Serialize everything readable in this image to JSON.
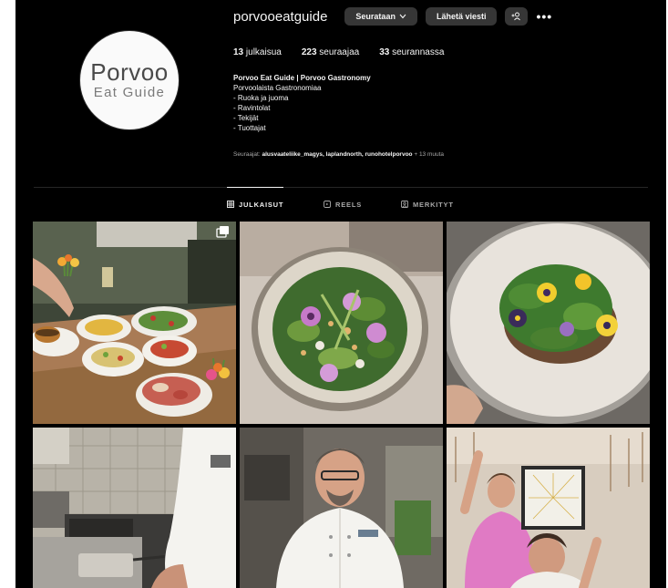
{
  "profile": {
    "username": "porvooeatguide",
    "following_btn": "Seurataan",
    "message_btn": "Lähetä viesti",
    "add_user_icon": "add-user-icon",
    "more_label": "•••"
  },
  "avatar": {
    "line1": "Porvoo",
    "line2": "Eat Guide"
  },
  "stats": {
    "posts": {
      "count": "13",
      "label": "julkaisua"
    },
    "followers": {
      "count": "223",
      "label": "seuraajaa"
    },
    "following": {
      "count": "33",
      "label": "seurannassa"
    }
  },
  "bio": {
    "name": "Porvoo Eat Guide | Porvoo Gastronomy",
    "lines": [
      "Porvoolaista Gastronomiaa",
      "- Ruoka ja juoma",
      "- Ravintolat",
      "- Tekijät",
      "- Tuottajat"
    ]
  },
  "followed_by": {
    "prefix": "Seuraajat:",
    "names": "alusvaateliike_magys, laplandnorth, runohotelporvoo",
    "more": "+ 13 muuta"
  },
  "tabs": [
    {
      "label": "JULKAISUT",
      "icon": "grid-icon",
      "active": true
    },
    {
      "label": "REELS",
      "icon": "reels-icon",
      "active": false
    },
    {
      "label": "MERKITYT",
      "icon": "tagged-icon",
      "active": false
    }
  ],
  "colors": {
    "background": "#000000",
    "button": "#363636",
    "text": "#f5f5f5",
    "muted": "#a8a8a8"
  }
}
